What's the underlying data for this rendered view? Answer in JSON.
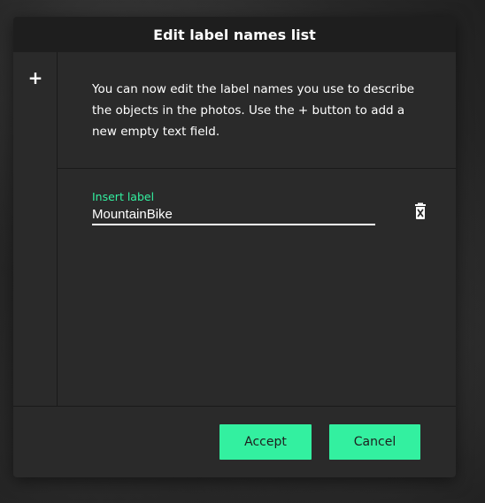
{
  "dialog": {
    "title": "Edit label names list",
    "add_button_label": "+",
    "description": "You can now edit the label names you use to describe the objects in the photos. Use the + button to add a new empty text field.",
    "fields": [
      {
        "label": "Insert label",
        "value": "MountainBike",
        "delete_icon": "delete-icon"
      }
    ],
    "accept_label": "Accept",
    "cancel_label": "Cancel"
  },
  "colors": {
    "accent": "#33f0a0",
    "dialog_bg": "#2a2a2a",
    "header_bg": "#1e1e1e",
    "text": "#ffffff"
  }
}
